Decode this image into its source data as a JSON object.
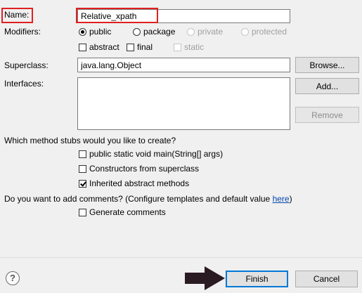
{
  "name_label": "Name:",
  "name_value": "Relative_xpath",
  "modifiers_label": "Modifiers:",
  "modifiers": {
    "public": "public",
    "package": "package",
    "private": "private",
    "protected": "protected",
    "abstract": "abstract",
    "final": "final",
    "static": "static"
  },
  "superclass_label": "Superclass:",
  "superclass_value": "java.lang.Object",
  "browse_label": "Browse...",
  "interfaces_label": "Interfaces:",
  "add_label": "Add...",
  "remove_label": "Remove",
  "stubs_question": "Which method stubs would you like to create?",
  "stubs": {
    "main": "public static void main(String[] args)",
    "constructors": "Constructors from superclass",
    "inherited": "Inherited abstract methods"
  },
  "comments_question_pre": "Do you want to add comments? (Configure templates and default value ",
  "comments_link": "here",
  "comments_question_post": ")",
  "generate_comments": "Generate comments",
  "help_symbol": "?",
  "finish_label": "Finish",
  "cancel_label": "Cancel",
  "colors": {
    "highlight": "#e02020",
    "arrow": "#2a1a22",
    "link": "#0645ad"
  }
}
